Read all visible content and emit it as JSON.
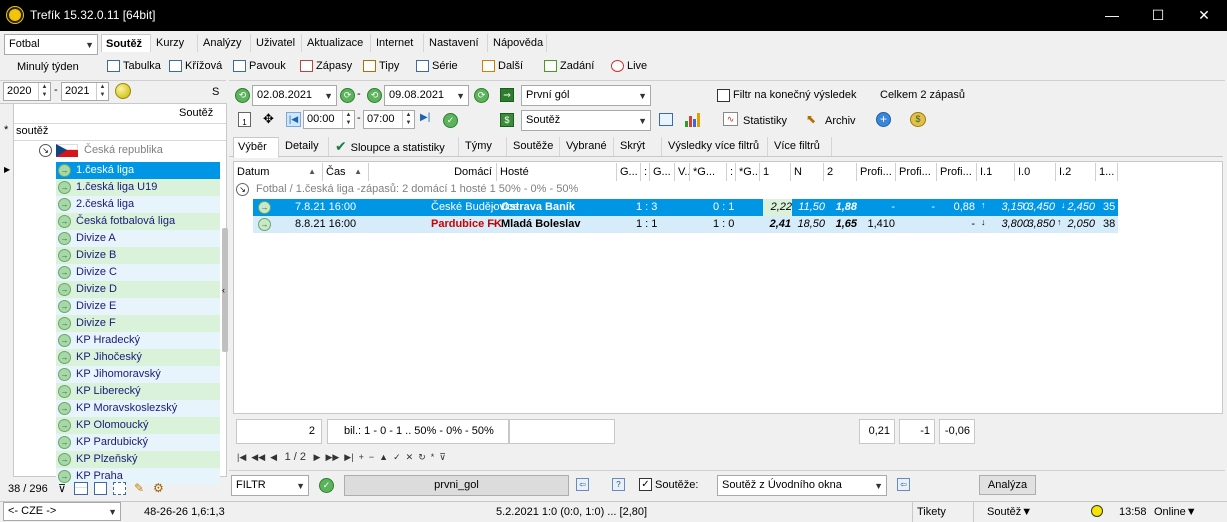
{
  "window": {
    "title": "Trefík 15.32.0.11 [64bit]",
    "min": "—",
    "max": "☐",
    "close": "✕"
  },
  "left": {
    "sport_value": "Fotbal",
    "minuly_tyden": "Minulý týden",
    "year_from": "2020",
    "year_to": "2021",
    "dash": "-",
    "col_s": "S",
    "col_soutez": "Soutěž",
    "filter_star": "*",
    "filter_text": "soutěž",
    "country": "Česká republika",
    "competitions": [
      "1.česká liga",
      "1.česká liga U19",
      "2.česká liga",
      "Česká fotbalová liga",
      "Divize A",
      "Divize B",
      "Divize C",
      "Divize D",
      "Divize E",
      "Divize F",
      "KP Hradecký",
      "KP Jihočeský",
      "KP Jihomoravský",
      "KP Liberecký",
      "KP Moravskoslezský",
      "KP Olomoucký",
      "KP Pardubický",
      "KP Plzeňský",
      "KP Praha"
    ],
    "count": "38 / 296"
  },
  "menu_tabs": [
    "Soutěž",
    "Kurzy",
    "Analýzy",
    "Uživatel",
    "Aktualizace",
    "Internet",
    "Nastavení",
    "Nápověda"
  ],
  "toolbar": [
    "Tabulka",
    "Křížová",
    "Pavouk",
    "Zápasy",
    "Tipy",
    "Série",
    "Další",
    "Zadání",
    "Live"
  ],
  "filter_bar": {
    "date_from": "02.08.2021",
    "date_to": "09.08.2021",
    "dash": "-",
    "event_type": "První gól",
    "filter_final_label": "Filtr na konečný výsledek",
    "total": "Celkem 2 zápasů",
    "time_from": "00:00",
    "time_to": "07:00",
    "soutez_combo": "Soutěž",
    "statistiky": "Statistiky",
    "archiv": "Archiv"
  },
  "sub_tabs": [
    "Výběr",
    "Detaily",
    "Sloupce a statistiky",
    "Týmy",
    "Soutěže",
    "Vybrané",
    "Skrýt",
    "Výsledky více filtrů",
    "Více filtrů"
  ],
  "grid": {
    "headers": [
      "Datum",
      "Čas",
      "Domácí",
      "Hosté",
      "G...",
      ":",
      "G...",
      "V..",
      "*G...",
      ":",
      "*G...",
      "1",
      "N",
      "2",
      "Profi...",
      "Profi...",
      "Profi...",
      "I.1",
      "I.0",
      "I.2",
      "1..."
    ],
    "group": "Fotbal / 1.česká liga -zápasů: 2  domácí 1   hosté 1      50% - 0% - 50%",
    "rows": [
      {
        "date": "7.8.21 16:00",
        "home": "České Budějovice",
        "sep": "-",
        "away": "Ostrava Baník",
        "score": "1 : 3",
        "ht": "0 : 1",
        "o1": "2,22",
        "oN": "11,50",
        "o2": "1,88",
        "p1": "-",
        "p2": "-",
        "p3": "0,88",
        "i1": "3,150",
        "i0": "3,450",
        "i2": "2,450",
        "last": "35"
      },
      {
        "date": "8.8.21 16:00",
        "home": "Pardubice FK",
        "sep": "-",
        "away": "Mladá Boleslav",
        "score": "1 : 1",
        "ht": "1 : 0",
        "o1": "2,41",
        "oN": "18,50",
        "o2": "1,65",
        "p1": "1,410",
        "p2": "",
        "p3": "-",
        "i1": "3,800",
        "i0": "3,850",
        "i2": "2,050",
        "last": "38"
      }
    ]
  },
  "summary": {
    "count": "2",
    "bil": "bil.: 1 - 0 - 1 .. 50% - 0% - 50%",
    "v1": "0,21",
    "v2": "-1",
    "v3": "-0,06"
  },
  "nav": {
    "page": "1 / 2"
  },
  "bottom": {
    "filtr": "FILTR",
    "filter_name": "prvni_gol",
    "souteze_label": "Soutěže:",
    "souteze_combo": "Soutěž z Úvodního okna",
    "analyza": "Analýza"
  },
  "status": {
    "cze": "<- CZE ->",
    "stats": "48-26-26  1,6:1,3",
    "match": "5.2.2021 1:0 (0:0, 1:0) ... [2,80]",
    "tikety": "Tikety",
    "soutez": "Soutěž▼",
    "time": "13:58",
    "online": "Online▼"
  },
  "colors": {
    "selected_row": "#0096e6",
    "tree_green": "#d9f2d9",
    "tree_blue": "#e8f4fc",
    "row2": "#d6ecfa",
    "accent_red": "#cc0000"
  }
}
